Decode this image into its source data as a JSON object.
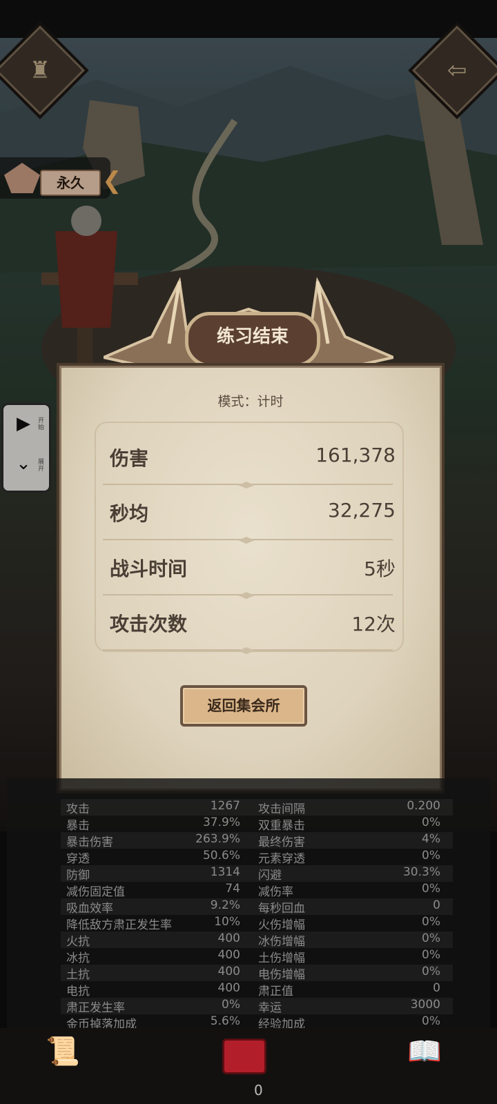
{
  "buff": {
    "label": "永久",
    "icon": "rank-emblem-icon"
  },
  "side": {
    "play_label": "开始",
    "expand_label": "展开"
  },
  "panel": {
    "title": "练习结束",
    "mode": "模式：计时",
    "stats": [
      {
        "label": "伤害",
        "value": "161,378"
      },
      {
        "label": "秒均",
        "value": "32,275"
      },
      {
        "label": "战斗时间",
        "value": "5秒"
      },
      {
        "label": "攻击次数",
        "value": "12次"
      }
    ],
    "back_button": "返回集会所"
  },
  "attributes": [
    {
      "n1": "攻击",
      "v1": "1267",
      "n2": "攻击间隔",
      "v2": "0.200"
    },
    {
      "n1": "暴击",
      "v1": "37.9%",
      "n2": "双重暴击",
      "v2": "0%"
    },
    {
      "n1": "暴击伤害",
      "v1": "263.9%",
      "n2": "最终伤害",
      "v2": "4%"
    },
    {
      "n1": "穿透",
      "v1": "50.6%",
      "n2": "元素穿透",
      "v2": "0%"
    },
    {
      "n1": "防御",
      "v1": "1314",
      "n2": "闪避",
      "v2": "30.3%"
    },
    {
      "n1": "减伤固定值",
      "v1": "74",
      "n2": "减伤率",
      "v2": "0%"
    },
    {
      "n1": "吸血效率",
      "v1": "9.2%",
      "n2": "每秒回血",
      "v2": "0"
    },
    {
      "n1": "降低敌方肃正发生率",
      "v1": "10%",
      "n2": "火伤增幅",
      "v2": "0%"
    },
    {
      "n1": "火抗",
      "v1": "400",
      "n2": "冰伤增幅",
      "v2": "0%"
    },
    {
      "n1": "冰抗",
      "v1": "400",
      "n2": "土伤增幅",
      "v2": "0%"
    },
    {
      "n1": "土抗",
      "v1": "400",
      "n2": "电伤增幅",
      "v2": "0%"
    },
    {
      "n1": "电抗",
      "v1": "400",
      "n2": "肃正值",
      "v2": "0"
    },
    {
      "n1": "肃正发生率",
      "v1": "0%",
      "n2": "幸运",
      "v2": "3000"
    },
    {
      "n1": "金币掉落加成",
      "v1": "5.6%",
      "n2": "经验加成",
      "v2": "0%"
    }
  ],
  "bottom": {
    "count": "0"
  },
  "colors": {
    "accent": "#dbb68a",
    "panel": "#e3d9c4",
    "chest": "#b21e2a"
  }
}
